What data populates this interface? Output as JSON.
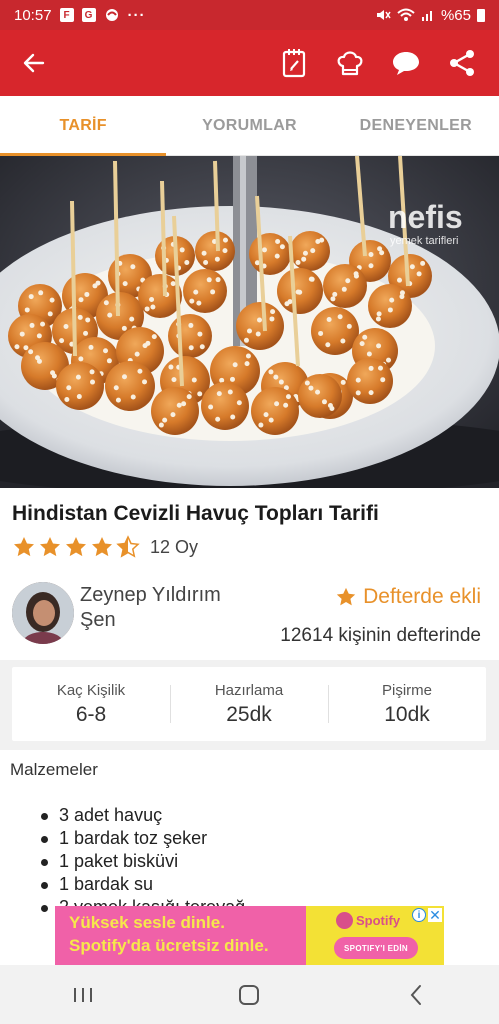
{
  "status_bar": {
    "time": "10:57",
    "app_icons": [
      "F",
      "G"
    ],
    "more": "···",
    "battery": "%65",
    "icons": [
      "mute-icon",
      "wifi-icon",
      "signal-icon",
      "battery-icon"
    ]
  },
  "app_bar": {
    "icons": [
      "back-arrow-icon",
      "notebook-icon",
      "chef-hat-icon",
      "comment-icon",
      "share-icon"
    ],
    "color": "#d7262c"
  },
  "tabs": [
    {
      "label": "TARİF",
      "active": true
    },
    {
      "label": "YORUMLAR",
      "active": false
    },
    {
      "label": "DENEYENLER",
      "active": false
    }
  ],
  "hero": {
    "watermark_main": "nefis",
    "watermark_sub": "yemek tarifleri"
  },
  "recipe": {
    "title": "Hindistan Cevizli Havuç Topları Tarifi",
    "rating": 4.5,
    "votes": "12 Oy"
  },
  "author": {
    "name": "Zeynep Yıldırım Şen",
    "bookmark_label": "Defterde ekli",
    "bookmark_count": "12614 kişinin defterinde"
  },
  "info": [
    {
      "label": "Kaç Kişilik",
      "value": "6-8"
    },
    {
      "label": "Hazırlama",
      "value": "25dk"
    },
    {
      "label": "Pişirme",
      "value": "10dk"
    }
  ],
  "ingredients": {
    "title": "Malzemeler",
    "items": [
      "3 adet havuç",
      "1 bardak toz şeker",
      "1 paket bisküvi",
      "1 bardak su",
      "2 yemek kaşığı tereyağ"
    ]
  },
  "ad": {
    "line1": "Yüksek sesle dinle.",
    "line2": "Spotify'da ücretsiz dinle.",
    "brand": "Spotify",
    "cta": "SPOTIFY'I EDİN",
    "info": "i",
    "close": "✕"
  },
  "nav_bar": {
    "icons": [
      "recent-apps-icon",
      "home-icon",
      "back-icon"
    ]
  },
  "colors": {
    "accent": "#e8912a",
    "brand_red": "#d7262c"
  }
}
